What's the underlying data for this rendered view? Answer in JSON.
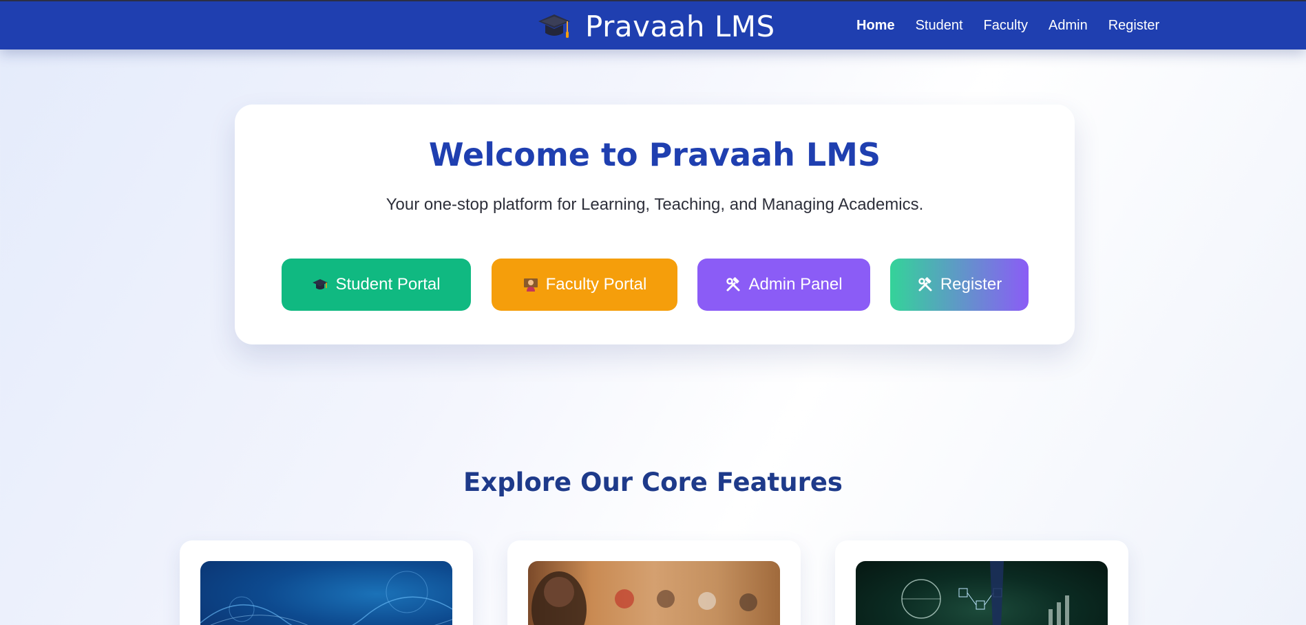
{
  "navbar": {
    "brand_icon": "graduation-cap-icon",
    "brand_name": "Pravaah LMS",
    "links": [
      {
        "label": "Home",
        "active": true
      },
      {
        "label": "Student",
        "active": false
      },
      {
        "label": "Faculty",
        "active": false
      },
      {
        "label": "Admin",
        "active": false
      },
      {
        "label": "Register",
        "active": false
      }
    ],
    "background_color": "#1f3fb0"
  },
  "hero": {
    "title": "Welcome to Pravaah LMS",
    "subtitle": "Your one-stop platform for Learning, Teaching, and Managing Academics.",
    "buttons": [
      {
        "label": "Student Portal",
        "icon": "graduation-cap-icon",
        "color": "#10b981"
      },
      {
        "label": "Faculty Portal",
        "icon": "teacher-icon",
        "color": "#f59e0b"
      },
      {
        "label": "Admin Panel",
        "icon": "tools-icon",
        "color": "#8b5cf6"
      },
      {
        "label": "Register",
        "icon": "tools-icon",
        "color": "#34d399-#8b5cf6"
      }
    ]
  },
  "features": {
    "title": "Explore Our Core Features",
    "cards": [
      {
        "image": "technology-abstract-image"
      },
      {
        "image": "classroom-teacher-image"
      },
      {
        "image": "business-network-image"
      }
    ]
  }
}
